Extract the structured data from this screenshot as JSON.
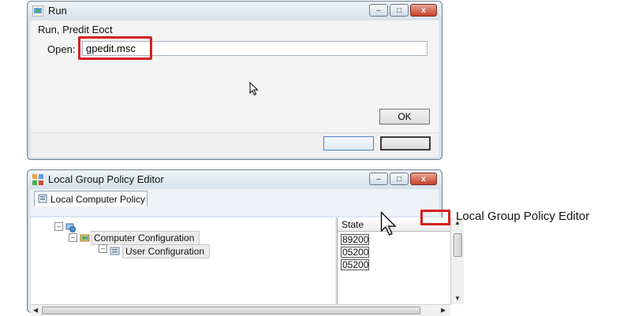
{
  "run_dialog": {
    "title": "Run",
    "description": "Run, Predit Eoct",
    "open_label": "Open:",
    "open_value": "gpedit.msc",
    "ok_label": "OK"
  },
  "gpe_window": {
    "title": "Local Group Policy Editor",
    "tab_label": "Local Computer Policy",
    "tree": {
      "computer_configuration": "Computer Configuration",
      "user_configuration": "User Configuration"
    },
    "state_header": "State",
    "state_values": [
      "89200",
      "05200",
      "05200"
    ]
  },
  "callout": {
    "label": "Local Group Policy Editor"
  },
  "window_controls": {
    "minimize": "–",
    "maximize": "□",
    "close": "x"
  },
  "icons": [
    "app-icon",
    "cursor-icon",
    "policy-icon",
    "computer-icon",
    "folder-icon",
    "expander-icon",
    "scroll-arrow-icon"
  ],
  "colors": {
    "highlight": "#d6201e",
    "chrome": "#dde6ef",
    "close": "#c7412a"
  }
}
